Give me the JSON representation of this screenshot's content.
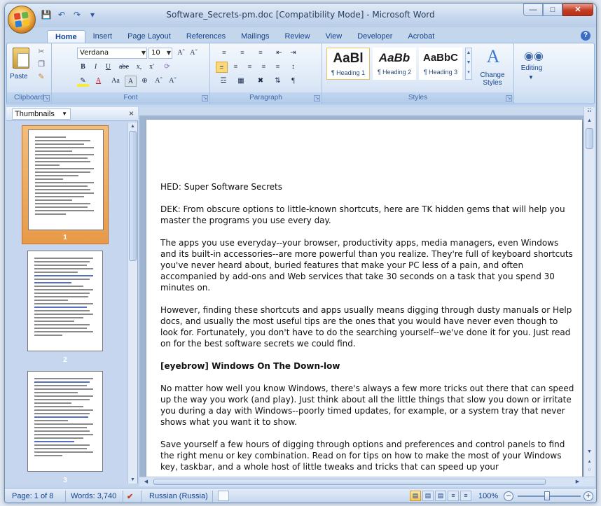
{
  "window": {
    "title": "Software_Secrets-pm.doc [Compatibility Mode] - Microsoft Word"
  },
  "quick_access": {
    "save_icon": "save-icon",
    "undo_icon": "undo-icon",
    "redo_icon": "redo-icon"
  },
  "tabs": [
    "Home",
    "Insert",
    "Page Layout",
    "References",
    "Mailings",
    "Review",
    "View",
    "Developer",
    "Acrobat"
  ],
  "ribbon": {
    "clipboard": {
      "label": "Clipboard",
      "paste": "Paste"
    },
    "font": {
      "label": "Font",
      "name": "Verdana",
      "size": "10",
      "bold": "B",
      "italic": "I",
      "underline": "U",
      "strike": "abe",
      "subscript": "x,",
      "superscript": "x'",
      "grow": "Aˆ",
      "shrink": "Aˇ",
      "change_case": "Aa",
      "clear": "A"
    },
    "paragraph": {
      "label": "Paragraph"
    },
    "styles": {
      "label": "Styles",
      "items": [
        {
          "preview": "AaBl",
          "name": "¶ Heading 1"
        },
        {
          "preview": "AaBb",
          "name": "¶ Heading 2"
        },
        {
          "preview": "AaBbC",
          "name": "¶ Heading 3"
        }
      ],
      "change_styles": "Change Styles"
    },
    "editing": {
      "label": "Editing"
    }
  },
  "nav_pane": {
    "view": "Thumbnails",
    "close": "×",
    "thumbnails": [
      "1",
      "2",
      "3"
    ]
  },
  "document": {
    "paragraphs": [
      "HED: Super Software Secrets",
      "DEK: From obscure options to little-known shortcuts, here are TK hidden gems that will help you master the programs you use every day.",
      "The apps you use everyday--your browser, productivity apps, media managers, even Windows and its built-in accessories--are more powerful than you realize. They're full of keyboard shortcuts you've never heard about, buried features that make your PC less of a pain, and often accompanied by add-ons and Web services that take 30 seconds on a task that you spend 30 minutes on.",
      "However, finding these shortcuts and apps usually means digging through dusty manuals or Help docs, and usually the most useful tips are the ones that you would have never even though to look for. Fortunately, you don't have to do the searching yourself--we've done it for you. Just read on for the best software secrets we could find.",
      "[eyebrow] Windows On The Down-low",
      "No matter how well you know Windows, there's always a few more tricks out there that can speed up the way you work (and play). Just think about all the little things that slow you down or irritate you during a day with Windows--poorly timed updates, for example, or a system tray that never shows what you want it to show.",
      "Save yourself a few hours of digging through options and preferences and control panels to find the right menu or key combination. Read on for tips on how to make the most of your Windows key, taskbar, and a whole host of little tweaks and tricks that can speed up your"
    ]
  },
  "status": {
    "page": "Page: 1 of 8",
    "words": "Words: 3,740",
    "language": "Russian (Russia)",
    "zoom": "100%"
  },
  "colors": {
    "accent": "#15428b",
    "selected_thumb": "#e89a48"
  }
}
